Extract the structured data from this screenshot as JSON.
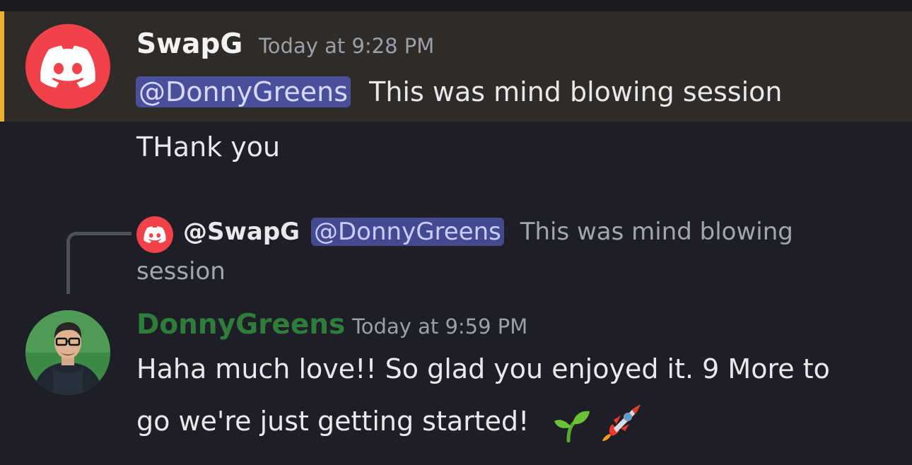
{
  "message1": {
    "username": "SwapG",
    "timestamp": "Today at 9:28 PM",
    "mention": "@DonnyGreens",
    "text": "This was mind blowing session",
    "text2": "THank you",
    "avatar_icon": "discord-logo-icon",
    "highlight_color": "#2f2b28",
    "accent_color": "#f0b132"
  },
  "reply_preview": {
    "username": "@SwapG",
    "mention": "@DonnyGreens",
    "text_line1": "This was mind blowing",
    "text_line2": "session",
    "avatar_icon": "discord-logo-icon"
  },
  "message2": {
    "username": "DonnyGreens",
    "username_color": "#2f7d3a",
    "timestamp": "Today at 9:59 PM",
    "text_line1": "Haha much love!! So glad you enjoyed it. 9 More to",
    "text_line2": "go we're just getting started!",
    "emojis": [
      "seedling-icon",
      "rocket-icon"
    ],
    "avatar_icon": "profile-photo-avatar"
  }
}
